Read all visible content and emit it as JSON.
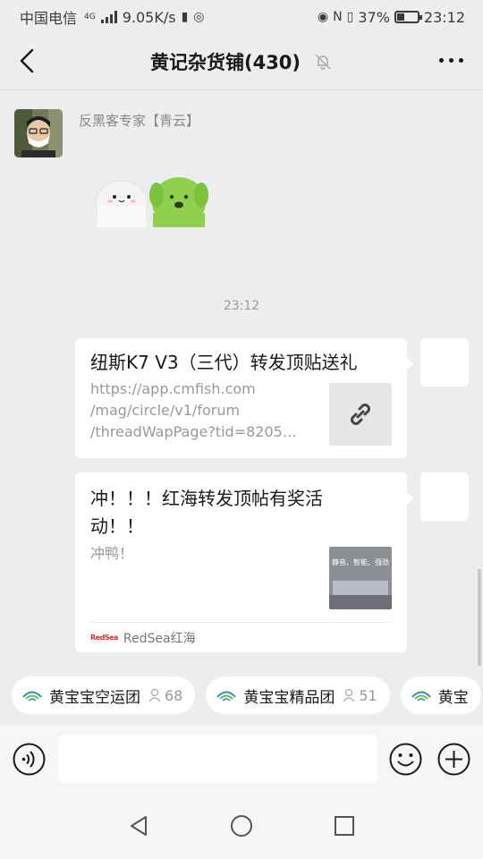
{
  "status_bar": {
    "carrier": "中国电信",
    "network_type": "4G",
    "speed": "9.05K/s",
    "battery_percent": "37%",
    "time": "23:12",
    "battery_level": 0.37
  },
  "nav": {
    "title": "黄记杂货铺(430)"
  },
  "messages": {
    "first_sender": "反黑客专家【青云】",
    "timestamp": "23:12",
    "card1": {
      "title": "纽斯K7 V3（三代）转发顶贴送礼",
      "desc_line1": "https://app.cmfish.com",
      "desc_line2": "/mag/circle/v1/forum",
      "desc_line3": "/threadWapPage?tid=8205…"
    },
    "card2": {
      "title_line1": "冲！！！红海转发顶帖有奖活",
      "title_line2": "动！！",
      "desc": "冲鸭！",
      "thumb_text": "静音、智能、强劲",
      "source_logo": "RedSea",
      "source": "RedSea红海"
    }
  },
  "groups": [
    {
      "name": "黄宝宝空运团",
      "count": "68"
    },
    {
      "name": "黄宝宝精品团",
      "count": "51"
    },
    {
      "name": "黄宝"
    }
  ],
  "input": {
    "placeholder": ""
  },
  "colors": {
    "background": "#ededed",
    "bubble": "#ffffff",
    "accent_green": "#07c160"
  }
}
